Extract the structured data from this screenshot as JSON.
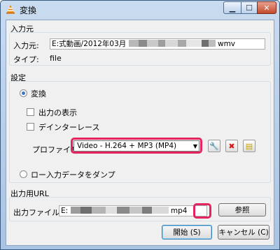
{
  "window": {
    "title": "変換"
  },
  "source": {
    "group_label": "入力元",
    "input_label": "入力元:",
    "input_value_start": "E:式動画/2012年03月",
    "input_value_end": "wmv",
    "type_label": "タイプ:",
    "type_value": "file"
  },
  "settings": {
    "group_label": "設定",
    "convert_label": "変換",
    "convert_selected": true,
    "show_output_label": "出力の表示",
    "show_output_checked": false,
    "deinterlace_label": "デインターレース",
    "deinterlace_checked": false,
    "profile_label": "プロファイル",
    "profile_value": "Video - H.264 + MP3 (MP4)",
    "dump_label": "ロー入力データをダンプ",
    "dump_selected": false
  },
  "destination": {
    "group_label": "出力用URL",
    "file_label": "出力ファイル:",
    "file_value_start": "E:",
    "file_value_end": "mp4",
    "browse_label": "参照"
  },
  "buttons": {
    "start_label": "開始 (S)",
    "cancel_label": "キャンセル (C)"
  },
  "colors": {
    "highlight": "#e3245e"
  },
  "icons": [
    "vlc-cone-icon",
    "wrench-icon",
    "delete-icon",
    "new-profile-icon"
  ]
}
